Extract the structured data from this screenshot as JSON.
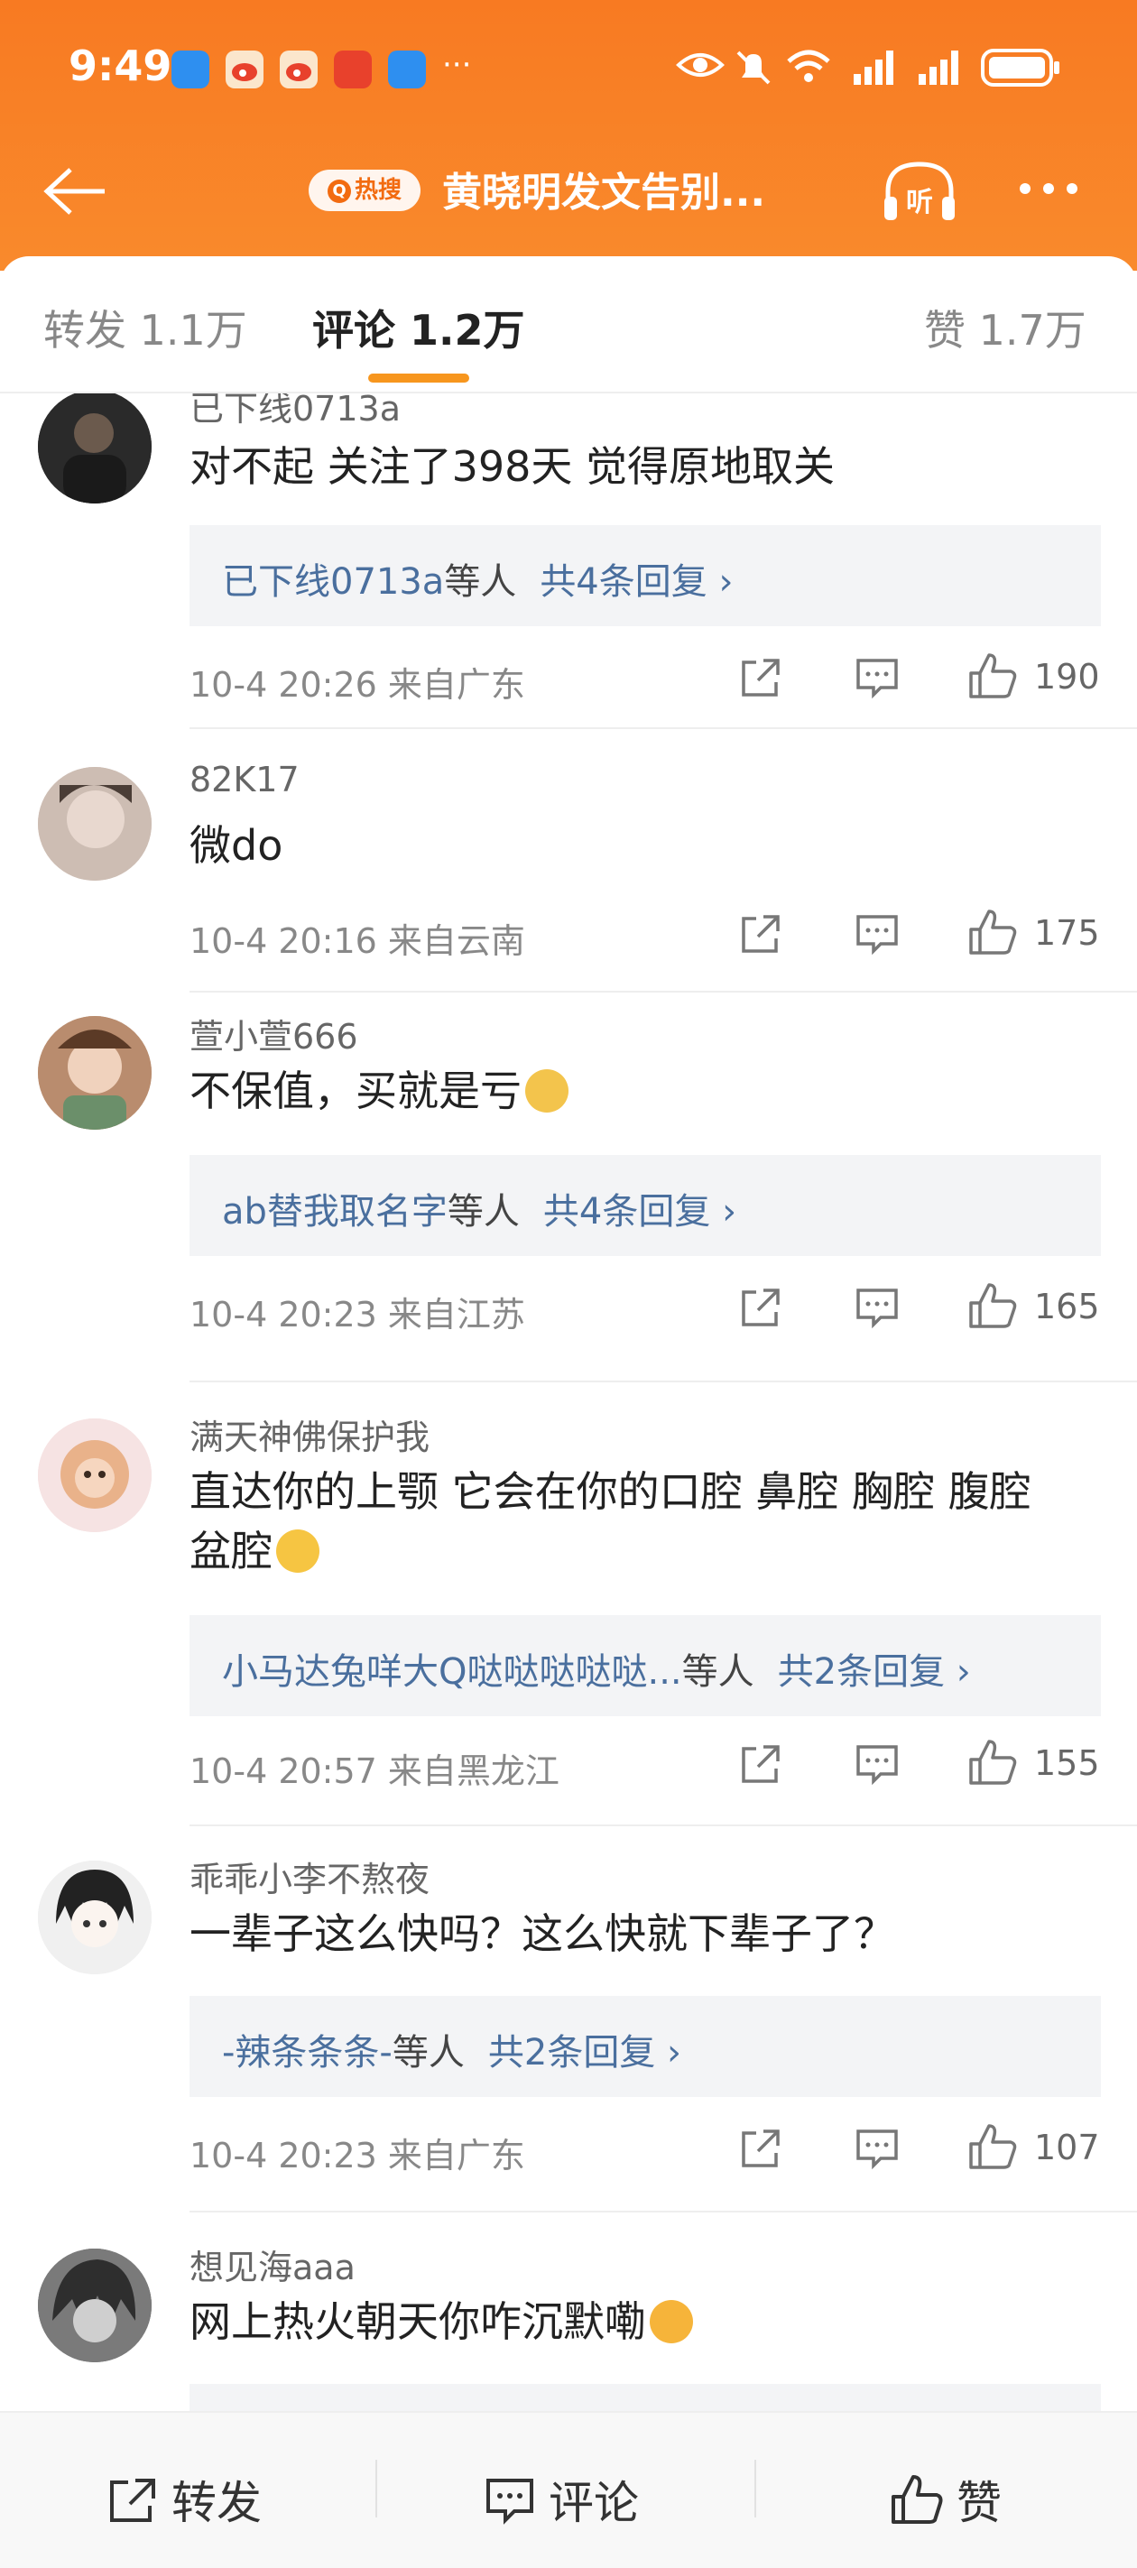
{
  "status": {
    "time": "9:49",
    "more": "···",
    "notif_colors": [
      "#2e8ff0",
      "#e8412c",
      "#e8412c",
      "#e8412c",
      "#2e8ff0"
    ]
  },
  "nav": {
    "hot_label": "热搜",
    "title": "黄晓明发文告别...",
    "listen_label": "听"
  },
  "tabs": {
    "repost": "转发 1.1万",
    "comment": "评论 1.2万",
    "like": "赞 1.7万"
  },
  "comments": [
    {
      "user": "已下线0713a",
      "text": "对不起 关注了398天 觉得原地取关",
      "reply_names": "已下线0713a",
      "reply_mid": "等人",
      "reply_count": "共4条回复 ›",
      "meta": "10-4 20:26 来自广东",
      "likes": "190"
    },
    {
      "user": "82K17",
      "text": "微do",
      "meta": "10-4 20:16 来自云南",
      "likes": "175"
    },
    {
      "user": "萱小萱666",
      "text": "不保值，买就是亏",
      "reply_names": "ab替我取名字",
      "reply_mid": "等人",
      "reply_count": "共4条回复 ›",
      "meta": "10-4 20:23 来自江苏",
      "likes": "165"
    },
    {
      "user": "满天神佛保护我",
      "text": "直达你的上颚 它会在你的口腔 鼻腔 胸腔 腹腔 盆腔",
      "reply_names": "小马达兔咩大Q哒哒哒哒哒...",
      "reply_mid": "等人",
      "reply_count": "共2条回复 ›",
      "meta": "10-4 20:57 来自黑龙江",
      "likes": "155"
    },
    {
      "user": "乖乖小李不熬夜",
      "text": "一辈子这么快吗？这么快就下辈子了？",
      "reply_names": "-辣条条条-",
      "reply_mid": "等人",
      "reply_count": "共2条回复 ›",
      "meta": "10-4 20:23 来自广东",
      "likes": "107"
    },
    {
      "user": "想见海aaa",
      "text": "网上热火朝天你咋沉默嘞"
    }
  ],
  "bottom": {
    "repost": "转发",
    "comment": "评论",
    "like": "赞"
  },
  "colors": {
    "header": "#f87a22",
    "accent_underline": "#f7961e",
    "link_blue": "#4a6f9e"
  }
}
